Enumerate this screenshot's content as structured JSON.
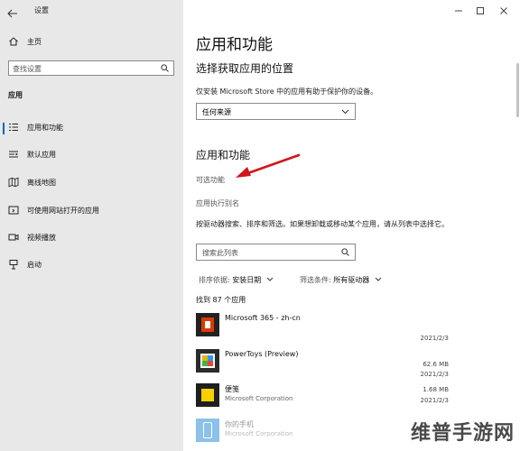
{
  "window": {
    "title": "设置",
    "back_icon": "arrow-left-icon",
    "minimize_icon": "minimize-icon",
    "maximize_icon": "maximize-icon",
    "close_icon": "close-icon"
  },
  "sidebar": {
    "home": {
      "label": "主页",
      "icon": "home-icon"
    },
    "search": {
      "placeholder": "查找设置",
      "icon": "search-icon"
    },
    "section": "应用",
    "items": [
      {
        "label": "应用和功能",
        "icon": "apps-list-icon",
        "selected": true
      },
      {
        "label": "默认应用",
        "icon": "default-apps-icon",
        "selected": false
      },
      {
        "label": "离线地图",
        "icon": "map-icon",
        "selected": false
      },
      {
        "label": "可使用网站打开的应用",
        "icon": "website-apps-icon",
        "selected": false
      },
      {
        "label": "视频播放",
        "icon": "video-icon",
        "selected": false
      },
      {
        "label": "启动",
        "icon": "startup-icon",
        "selected": false
      }
    ]
  },
  "main": {
    "page_title": "应用和功能",
    "install_section": {
      "heading": "选择获取应用的位置",
      "description": "仅安装 Microsoft Store 中的应用有助于保护你的设备。",
      "dropdown_value": "任何来源"
    },
    "apps_section": {
      "heading": "应用和功能",
      "optional_features": "可选功能",
      "execution_alias": "应用执行别名",
      "search_description": "按驱动器搜索、排序和筛选。如果想卸载或移动某个应用，请从列表中选择它。",
      "search_placeholder": "搜索此列表",
      "sort_label": "排序依据:",
      "sort_value": "安装日期",
      "filter_label": "筛选条件:",
      "filter_value": "所有驱动器",
      "count_text": "找到 87 个应用"
    },
    "apps": [
      {
        "name": "Microsoft 365 - zh-cn",
        "publisher": "",
        "size": "",
        "date": "2021/2/3",
        "icon": "office-icon",
        "color": "#d83b01"
      },
      {
        "name": "PowerToys (Preview)",
        "publisher": "",
        "size": "62.6 MB",
        "date": "2021/2/3",
        "icon": "powertoys-icon",
        "color": "#2b2b2b"
      },
      {
        "name": "便笺",
        "publisher": "Microsoft Corporation",
        "size": "1.68 MB",
        "date": "2021/2/3",
        "icon": "sticky-notes-icon",
        "color": "#1f1f1f"
      },
      {
        "name": "你的手机",
        "publisher": "Microsoft Corporation",
        "size": "",
        "date": "",
        "icon": "your-phone-icon",
        "color": "#0078d4"
      }
    ]
  },
  "annotation": {
    "arrow_color": "#d0161b"
  },
  "watermark": {
    "text": "维普手游网"
  }
}
